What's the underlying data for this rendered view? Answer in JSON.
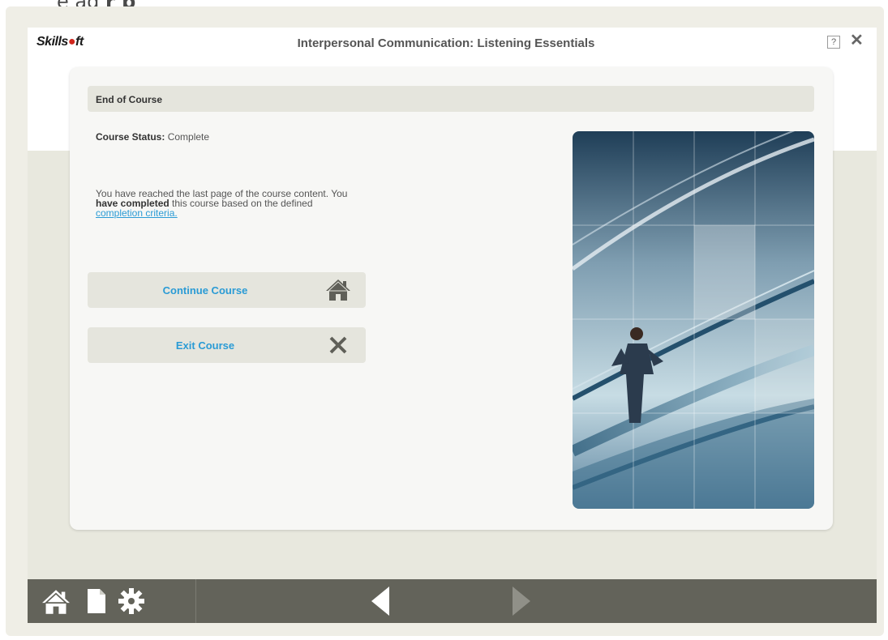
{
  "page_top_fragment": {
    "prefix": "e ag",
    "bold": "r p"
  },
  "header": {
    "logo_text_before": "Skills",
    "logo_text_after": "ft",
    "title": "Interpersonal Communication: Listening Essentials",
    "help_label": "?",
    "close_label": "✕"
  },
  "panel": {
    "heading": "End of Course",
    "status_label": "Course Status:",
    "status_value": "Complete",
    "message_part1": "You have reached the last page of the course content. You",
    "message_bold": "have completed",
    "message_part2": "this course based on the defined",
    "message_link": "completion criteria."
  },
  "buttons": {
    "continue_label": "Continue Course",
    "exit_label": "Exit Course"
  },
  "icons": {
    "continue": "home-icon",
    "exit": "close-x-icon",
    "toolbar": [
      "home-icon",
      "document-icon",
      "gear-icon",
      "back-arrow-icon",
      "forward-arrow-icon"
    ]
  },
  "colors": {
    "accent_link": "#2a9bd5",
    "toolbar_bg": "#63635a",
    "logo_dot": "#d0261d"
  }
}
